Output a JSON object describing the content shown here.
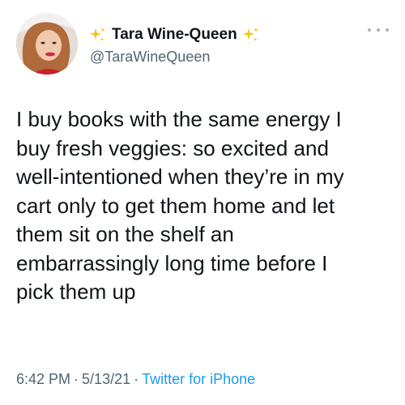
{
  "tweet": {
    "display_name": "Tara Wine-Queen",
    "handle": "@TaraWineQueen",
    "text": "I buy books with the same energy I\nbuy fresh veggies: so excited and\nwell-intentioned when they’re in my\ncart only to get them home and let\nthem sit on the shelf an\nembarrassingly long time before I\npick them up",
    "time": "6:42 PM",
    "date": "5/13/21",
    "separator": "·",
    "source": "Twitter for iPhone"
  },
  "icons": {
    "leading_emoji": "sparkles-icon",
    "trailing_emoji": "sparkles-icon",
    "menu": "more-options-icon"
  },
  "colors": {
    "text": "#0f1419",
    "secondary": "#536471",
    "link": "#1d9bf0",
    "sparkle": "#f5c518"
  }
}
